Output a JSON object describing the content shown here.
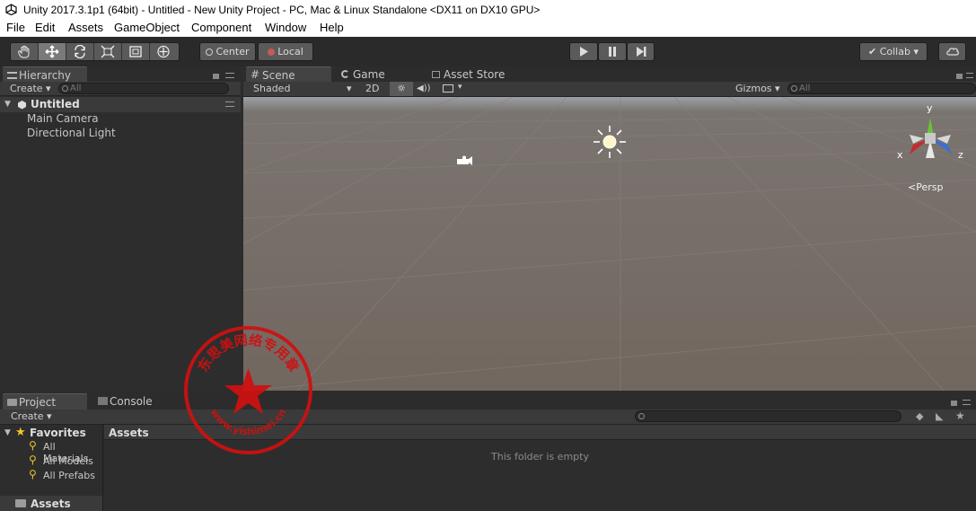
{
  "window": {
    "title": "Unity 2017.3.1p1 (64bit) - Untitled - New Unity Project - PC, Mac & Linux Standalone <DX11 on DX10 GPU>"
  },
  "menu": [
    "File",
    "Edit",
    "Assets",
    "GameObject",
    "Component",
    "Window",
    "Help"
  ],
  "toolbar": {
    "tools": [
      "hand-tool-icon",
      "move-tool-icon",
      "rotate-tool-icon",
      "scale-tool-icon",
      "rect-tool-icon",
      "transform-tool-icon"
    ],
    "pivot": "Center",
    "space": "Local",
    "collab": "Collab",
    "colors": {
      "bg": "#2a2a2a",
      "button": "#5a5a5a"
    }
  },
  "hierarchy": {
    "tab": "Hierarchy",
    "create": "Create",
    "search_placeholder": "All",
    "scene": "Untitled",
    "items": [
      "Main Camera",
      "Directional Light"
    ]
  },
  "scene_view": {
    "tabs": [
      "Scene",
      "Game",
      "Asset Store"
    ],
    "shading": "Shaded",
    "mode_2d": "2D",
    "gizmos": "Gizmos",
    "search_placeholder": "All",
    "persp": "Persp",
    "axes": {
      "x": "x",
      "y": "y",
      "z": "z"
    },
    "colors": {
      "sky": "#9ca0a6",
      "ground": "#746860"
    }
  },
  "project": {
    "tabs": [
      "Project",
      "Console"
    ],
    "create": "Create",
    "favorites": "Favorites",
    "favorite_items": [
      "All Materials",
      "All Models",
      "All Prefabs"
    ],
    "assets_root": "Assets",
    "breadcrumb": "Assets",
    "empty": "This folder is empty"
  },
  "stamp": {
    "text_top": "东思美网络专用章",
    "text_bottom": "www.yishimei.cn"
  }
}
